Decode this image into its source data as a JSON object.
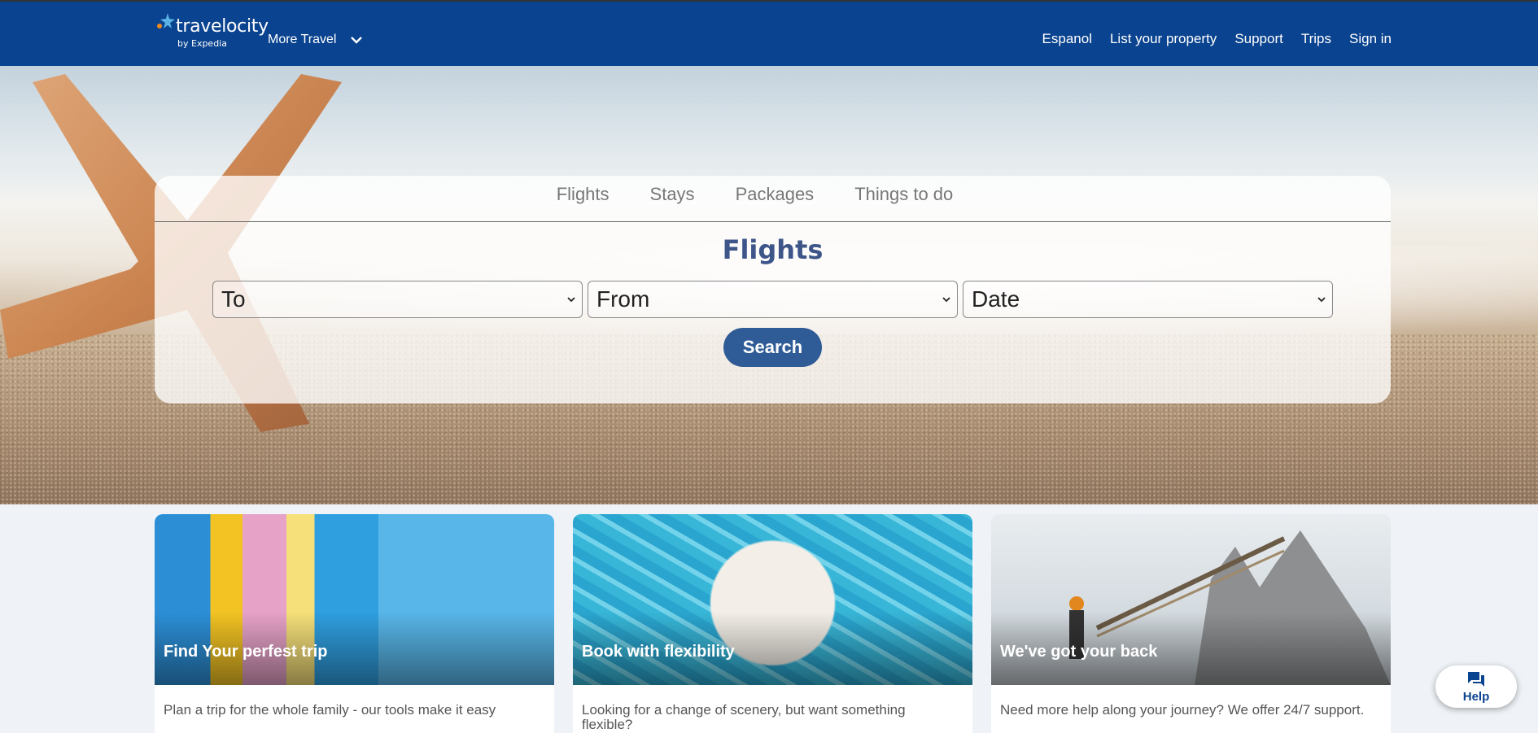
{
  "header": {
    "logo_text": "travelocity",
    "logo_sub": "by Expedia",
    "more_travel": "More Travel",
    "nav": [
      "Espanol",
      "List your property",
      "Support",
      "Trips",
      "Sign in"
    ]
  },
  "search": {
    "tabs": [
      "Flights",
      "Stays",
      "Packages",
      "Things to do"
    ],
    "title": "Flights",
    "selects": [
      "To",
      "From",
      "Date"
    ],
    "button": "Search"
  },
  "cards": [
    {
      "title": "Find Your perfest trip",
      "text": "Plan a trip for the whole family - our tools make it easy"
    },
    {
      "title": "Book with flexibility",
      "text": "Looking for a change of scenery, but want something flexible?"
    },
    {
      "title": "We've got your back",
      "text": "Need more help along your journey? We offer 24/7 support."
    }
  ],
  "help": {
    "label": "Help"
  },
  "colors": {
    "header": "#0a438f",
    "button": "#2f5b96",
    "title": "#3d5589"
  }
}
